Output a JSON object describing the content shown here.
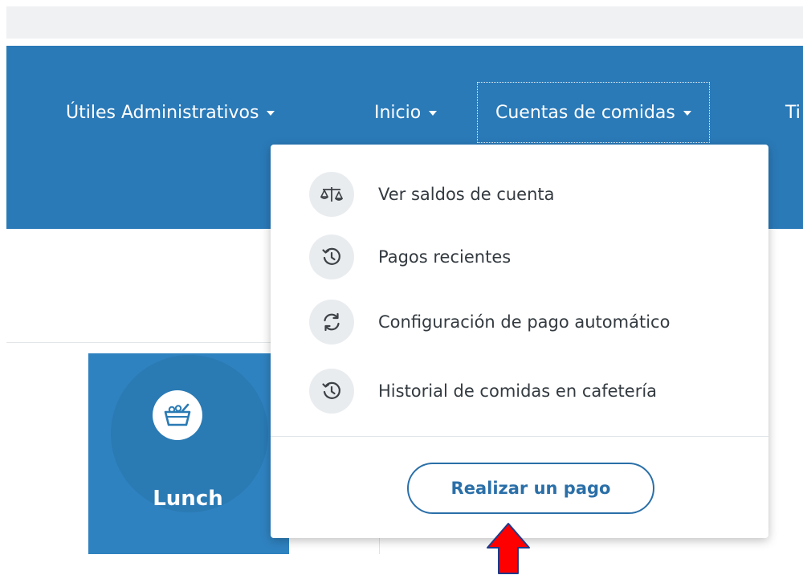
{
  "nav": {
    "items": [
      {
        "label": "Útiles Administrativos"
      },
      {
        "label": "Inicio"
      },
      {
        "label": "Cuentas de comidas"
      },
      {
        "label": "Ti"
      }
    ]
  },
  "dropdown": {
    "items": [
      {
        "label": "Ver saldos de cuenta",
        "icon": "balance-scale-icon"
      },
      {
        "label": "Pagos recientes",
        "icon": "history-icon"
      },
      {
        "label": "Configuración de pago automático",
        "icon": "sync-icon"
      },
      {
        "label": "Historial de comidas en cafetería",
        "icon": "history-icon"
      }
    ],
    "action_button": "Realizar un pago"
  },
  "cards": [
    {
      "label": "Lunch",
      "icon": "lunch-basket-icon"
    }
  ],
  "colors": {
    "nav_bg": "#2a7ab8",
    "card_bg": "#2f82c0",
    "button_accent": "#2a6fa8",
    "annotation_arrow": "#ff0000"
  }
}
